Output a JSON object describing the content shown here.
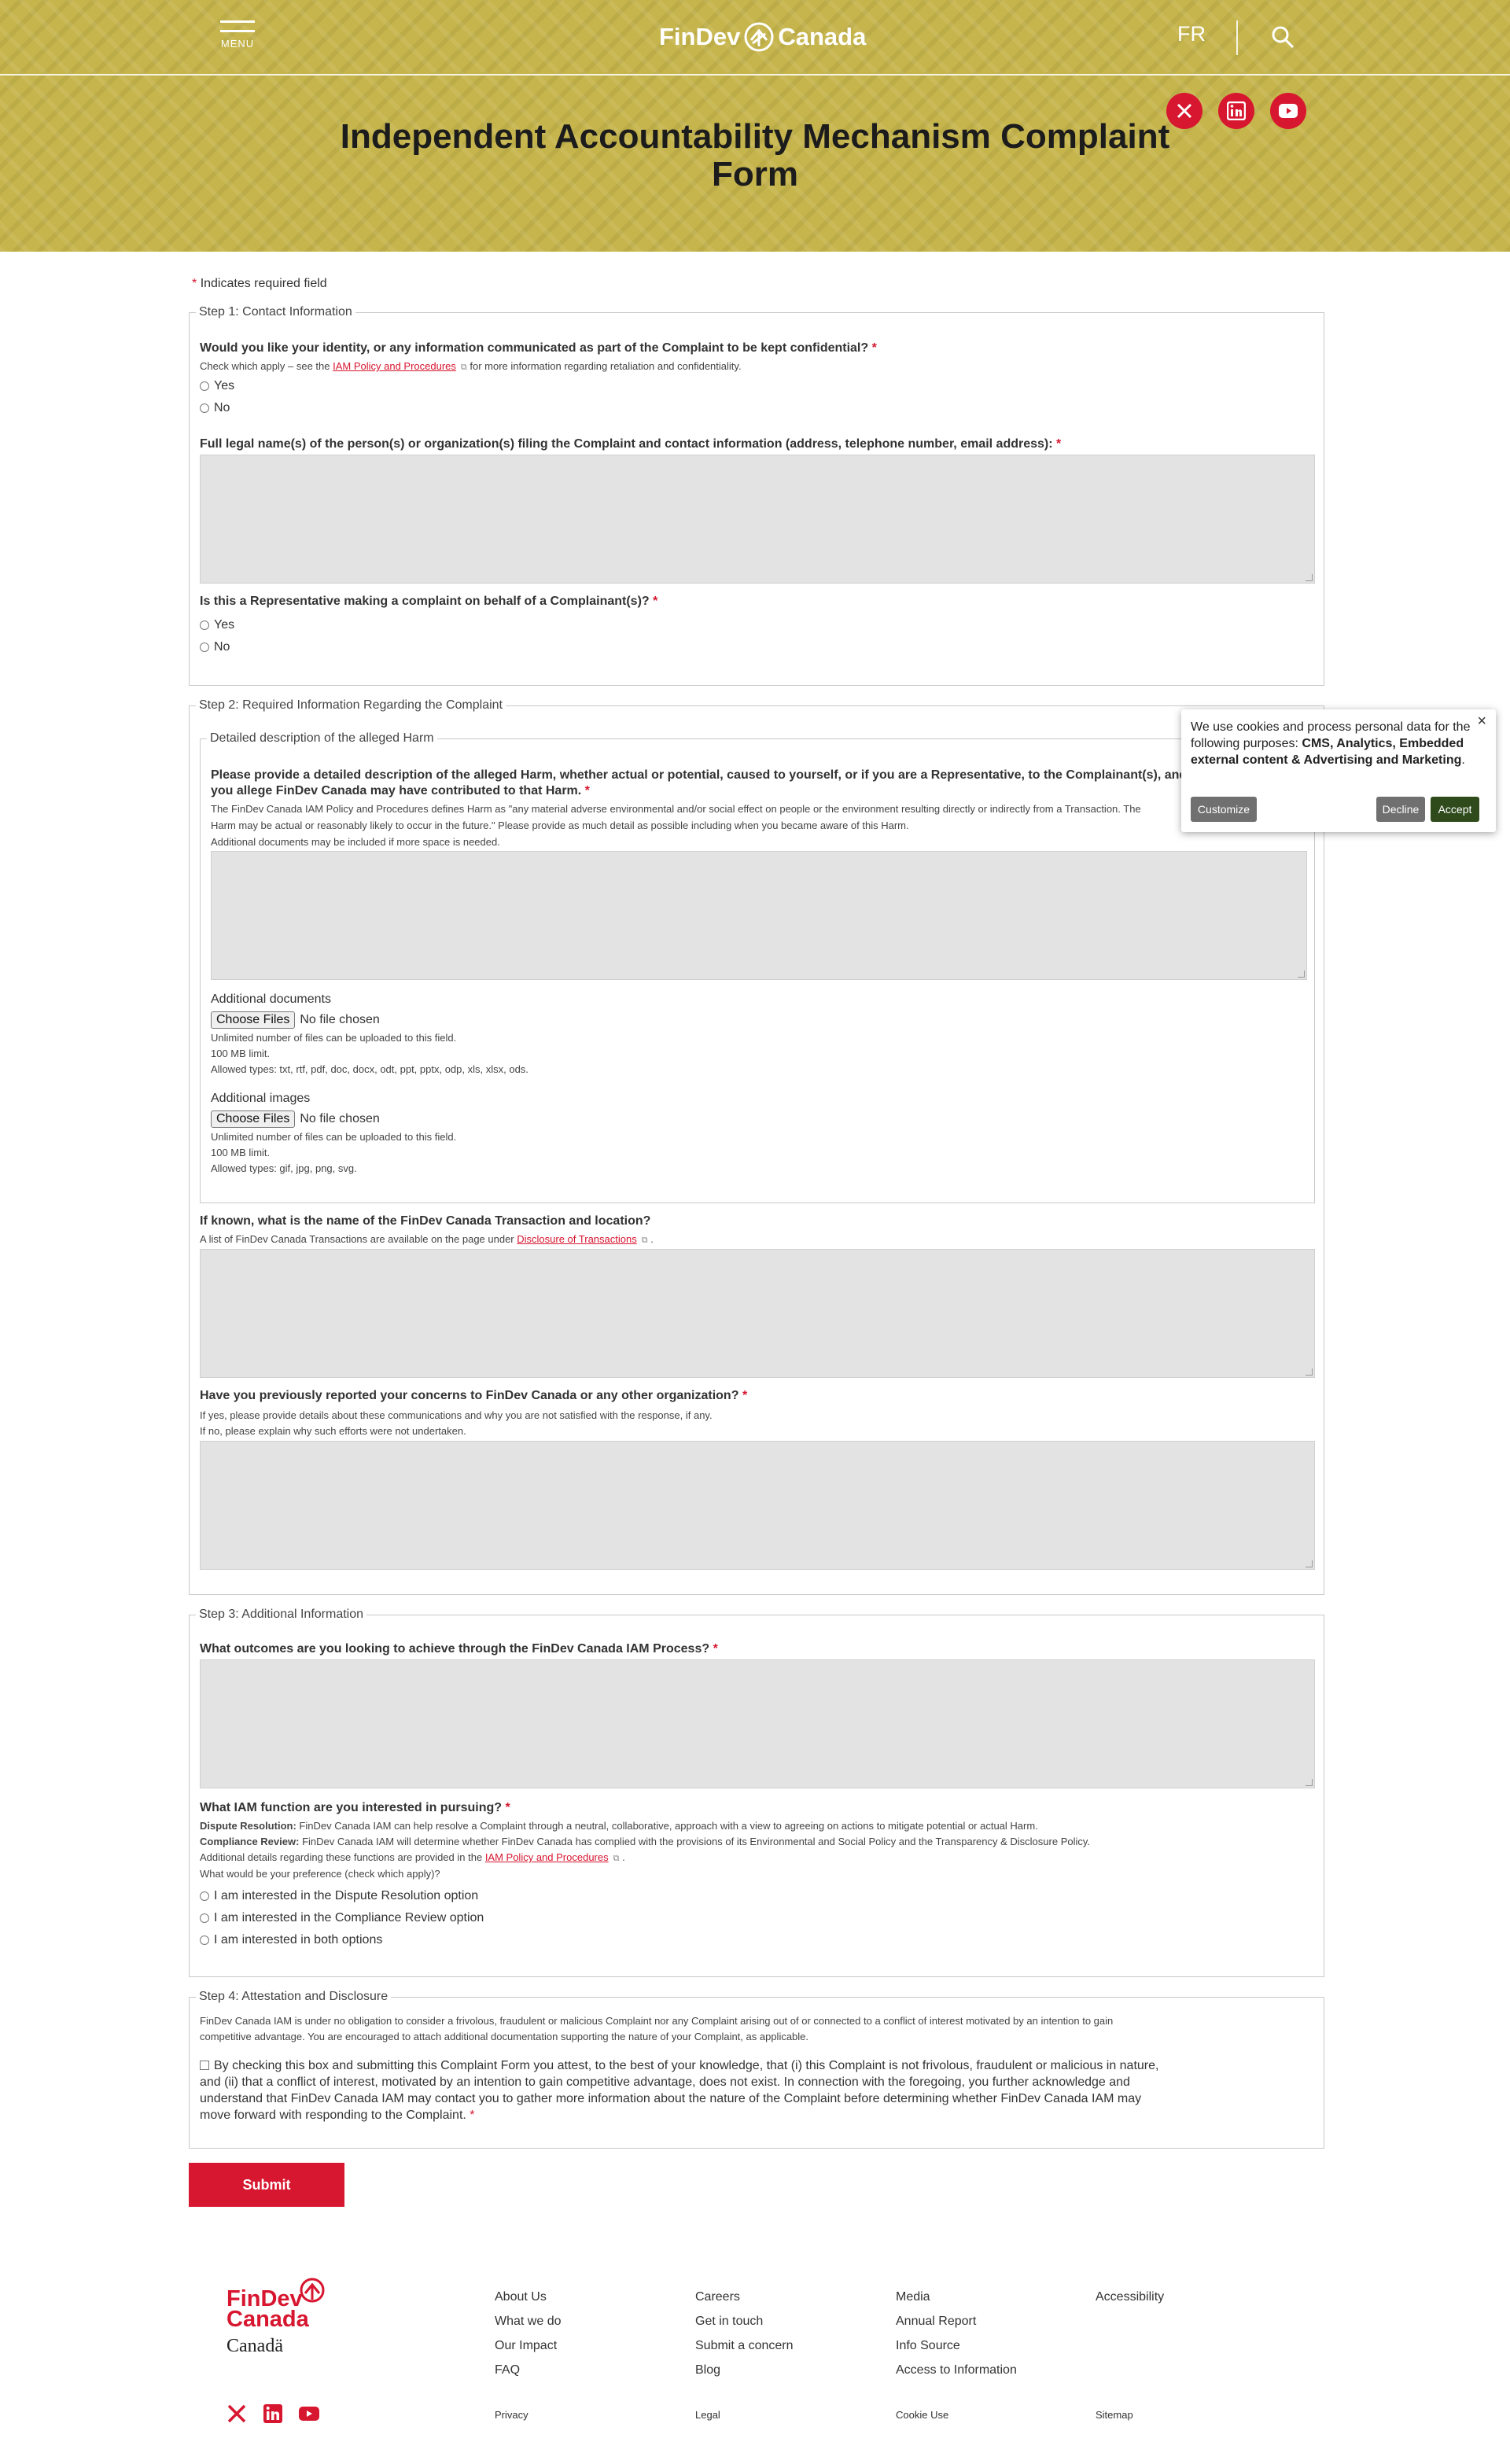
{
  "header": {
    "menu_label": "MENU",
    "logo_text_left": "FinDev",
    "logo_text_right": "Canada",
    "language_toggle": "FR",
    "page_title": "Independent Accountability Mechanism Complaint Form",
    "social": [
      "x-icon",
      "linkedin-icon",
      "youtube-icon"
    ]
  },
  "form": {
    "required_note": "Indicates required field",
    "step1": {
      "legend": "Step 1: Contact Information",
      "q_confidential": "Would you like your identity, or any information communicated as part of the Complaint to be kept confidential?",
      "q_confidential_desc_pre": "Check which apply – see the",
      "q_confidential_link": "IAM Policy and Procedures",
      "q_confidential_desc_post": "for more information regarding retaliation and confidentiality.",
      "opt_yes": "Yes",
      "opt_no": "No",
      "q_names": "Full legal name(s) of the person(s) or organization(s) filing the Complaint and contact information (address, telephone number, email address):",
      "q_representative": "Is this a Representative making a complaint on behalf of a Complainant(s)?",
      "rep_yes": "Yes",
      "rep_no": "No"
    },
    "step2": {
      "legend": "Step 2: Required Information Regarding the Complaint",
      "harm_legend": "Detailed description of the alleged Harm",
      "q_harm_line1": "Please provide a detailed description of the alleged Harm, whether actual or potential, caused to yourself, or if you are a Representative, to the Complainant(s), and how",
      "q_harm_line2": "you allege FinDev Canada may have contributed to that Harm.",
      "harm_desc1": "The FinDev Canada IAM Policy and Procedures defines Harm as \"any material adverse environmental and/or social effect on people or the environment resulting directly or indirectly from a Transaction. The",
      "harm_desc2": "Harm may be actual or reasonably likely to occur in the future.\" Please provide as much detail as possible including when you became aware of this Harm.",
      "harm_desc3": "Additional documents may be included if more space is needed.",
      "docs_label": "Additional documents",
      "choose_files": "Choose Files",
      "no_file": "No file chosen",
      "docs_limit1": "Unlimited number of files can be uploaded to this field.",
      "docs_limit2": "100 MB limit.",
      "docs_types": "Allowed types: txt, rtf, pdf, doc, docx, odt, ppt, pptx, odp, xls, xlsx, ods.",
      "images_label": "Additional images",
      "images_choose": "Choose Files",
      "images_no_file": "No file chosen",
      "images_limit1": "Unlimited number of files can be uploaded to this field.",
      "images_limit2": "100 MB limit.",
      "images_types": "Allowed types: gif, jpg, png, svg.",
      "q_transaction": "If known, what is the name of the FinDev Canada Transaction and location?",
      "transaction_desc_pre": "A list of FinDev Canada Transactions are available on the page under",
      "transaction_link": "Disclosure of Transactions",
      "transaction_desc_post": ".",
      "q_reported": "Have you previously reported your concerns to FinDev Canada or any other organization?",
      "reported_desc1": "If yes, please provide details about these communications and why you are not satisfied with the response, if any.",
      "reported_desc2": "If no, please explain why such efforts were not undertaken."
    },
    "step3": {
      "legend": "Step 3: Additional Information",
      "q_outcomes": "What outcomes are you looking to achieve through the FinDev Canada IAM Process?",
      "q_function": "What IAM function are you interested in pursuing?",
      "dispute_label": "Dispute Resolution:",
      "dispute_text": "FinDev Canada IAM can help resolve a Complaint through a neutral, collaborative, approach with a view to agreeing on actions to mitigate potential or actual Harm.",
      "compliance_label": "Compliance Review:",
      "compliance_text": "FinDev Canada IAM will determine whether FinDev Canada has complied with the provisions of its Environmental and Social Policy and the Transparency & Disclosure Policy.",
      "details_pre": "Additional details regarding these functions are provided in the",
      "details_link": "IAM Policy and Procedures",
      "details_post": ".",
      "preference": "What would be your preference (check which apply)?",
      "opt1": "I am interested in the Dispute Resolution option",
      "opt2": "I am interested in the Compliance Review option",
      "opt3": "I am interested in both options"
    },
    "step4": {
      "legend": "Step 4: Attestation and Disclosure",
      "intro1": "FinDev Canada IAM is under no obligation to consider a frivolous, fraudulent or malicious Complaint nor any Complaint arising out of or connected to a conflict of interest motivated by an intention to gain",
      "intro2": "competitive advantage. You are encouraged to attach additional documentation supporting the nature of your Complaint, as applicable.",
      "attest1": "By checking this box and submitting this Complaint Form you attest, to the best of your knowledge, that (i) this Complaint is not frivolous, fraudulent or malicious in nature,",
      "attest2": "and (ii) that a conflict of interest, motivated by an intention to gain competitive advantage, does not exist. In connection with the foregoing, you further acknowledge and",
      "attest3": "understand that FinDev Canada IAM may contact you to gather more information about the nature of the Complaint before determining whether FinDev Canada IAM may",
      "attest4": "move forward with responding to the Complaint."
    },
    "submit_label": "Submit"
  },
  "cookie_banner": {
    "text_pre": "We use cookies and process personal data for the following purposes:",
    "text_bold": "CMS, Analytics, Embedded external content & Advertising and Marketing",
    "text_post": ".",
    "customize": "Customize",
    "decline": "Decline",
    "accept": "Accept",
    "close": "×"
  },
  "footer": {
    "logo_line1": "FinDev",
    "logo_line2": "Canada",
    "wordmark": "Canadä",
    "col1": [
      "About Us",
      "What we do",
      "Our Impact",
      "FAQ"
    ],
    "col2": [
      "Careers",
      "Get in touch",
      "Submit a concern",
      "Blog"
    ],
    "col3": [
      "Media",
      "Annual Report",
      "Info Source",
      "Access to Information"
    ],
    "col4": [
      "Accessibility"
    ],
    "bottom": [
      "Privacy",
      "Legal",
      "Cookie Use",
      "Sitemap"
    ]
  },
  "colors": {
    "brand_red": "#d7162f",
    "header_gold": "#c6b54c",
    "textarea_bg": "#e3e3e3",
    "accept_green": "#2f4b1c",
    "decline_gray": "#707070"
  }
}
